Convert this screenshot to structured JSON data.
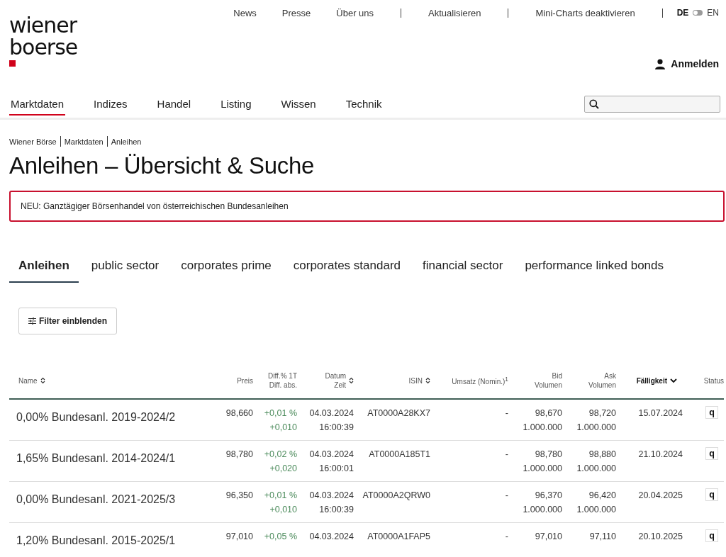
{
  "logo": {
    "line1": "wiener",
    "line2": "boerse"
  },
  "top_link_groups": [
    [
      "News",
      "Presse",
      "Über uns"
    ],
    [
      "Aktualisieren"
    ],
    [
      "Mini-Charts deaktivieren"
    ]
  ],
  "languages": [
    {
      "label": "DE",
      "selected": true
    },
    {
      "label": "EN",
      "selected": false
    }
  ],
  "login": "Anmelden",
  "nav": [
    {
      "label": "Marktdaten",
      "selected": true
    },
    {
      "label": "Indizes",
      "selected": false
    },
    {
      "label": "Handel",
      "selected": false
    },
    {
      "label": "Listing",
      "selected": false
    },
    {
      "label": "Wissen",
      "selected": false
    },
    {
      "label": "Technik",
      "selected": false
    }
  ],
  "breadcrumbs": [
    "Wiener Börse",
    "Marktdaten",
    "Anleihen"
  ],
  "title": "Anleihen – Übersicht & Suche",
  "notice": "NEU: Ganztägiger Börsenhandel von österreichischen Bundesanleihen",
  "tabs": [
    {
      "label": "Anleihen",
      "selected": true
    },
    {
      "label": "public sector",
      "selected": false
    },
    {
      "label": "corporates prime",
      "selected": false
    },
    {
      "label": "corporates standard",
      "selected": false
    },
    {
      "label": "financial sector",
      "selected": false
    },
    {
      "label": "performance linked bonds",
      "selected": false
    }
  ],
  "filter_button": "Filter einblenden",
  "table": {
    "columns": [
      {
        "label": "Name",
        "sortable": true,
        "sorted": false
      },
      {
        "label": "Preis",
        "sortable": false,
        "sorted": false
      },
      {
        "label": "Diff.% 1T",
        "label2": "Diff. abs.",
        "sortable": false,
        "sorted": false
      },
      {
        "label": "Datum",
        "label2": "Zeit",
        "sortable": true,
        "sorted": false
      },
      {
        "label": "ISIN",
        "sortable": true,
        "sorted": false
      },
      {
        "label": "Umsatz (Nomin.)$^{1}$",
        "sortable": false,
        "sorted": false
      },
      {
        "label": "Bid",
        "label2": "Volumen",
        "sortable": false,
        "sorted": false
      },
      {
        "label": "Ask",
        "label2": "Volumen",
        "sortable": false,
        "sorted": false
      },
      {
        "label": "Fälligkeit",
        "sortable": false,
        "sorted": true
      },
      {
        "label": "Status",
        "sortable": false,
        "sorted": false
      }
    ],
    "rows": [
      {
        "name": "0,00% Bundesanl. 2019-2024/2",
        "price": "98,660",
        "diff_pct": "+0,01 %",
        "diff_abs": "+0,010",
        "date": "04.03.2024",
        "time": "16:00:39",
        "isin": "AT0000A28KX7",
        "turnover": "-",
        "bid": "98,670",
        "bid_volume": "1.000.000",
        "ask": "98,720",
        "ask_volume": "1.000.000",
        "maturity": "15.07.2024",
        "status": "q"
      },
      {
        "name": "1,65% Bundesanl. 2014-2024/1",
        "price": "98,780",
        "diff_pct": "+0,02 %",
        "diff_abs": "+0,020",
        "date": "04.03.2024",
        "time": "16:00:01",
        "isin": "AT0000A185T1",
        "turnover": "-",
        "bid": "98,780",
        "bid_volume": "1.000.000",
        "ask": "98,880",
        "ask_volume": "1.000.000",
        "maturity": "21.10.2024",
        "status": "q"
      },
      {
        "name": "0,00% Bundesanl. 2021-2025/3",
        "price": "96,350",
        "diff_pct": "+0,01 %",
        "diff_abs": "+0,010",
        "date": "04.03.2024",
        "time": "16:00:39",
        "isin": "AT0000A2QRW0",
        "turnover": "-",
        "bid": "96,370",
        "bid_volume": "1.000.000",
        "ask": "96,420",
        "ask_volume": "1.000.000",
        "maturity": "20.04.2025",
        "status": "q"
      },
      {
        "name": "1,20% Bundesanl. 2015-2025/1",
        "price": "97,010",
        "diff_pct": "+0,05 %",
        "date": "04.03.2024",
        "isin": "AT0000A1FAP5",
        "turnover": "-",
        "bid": "97,010",
        "ask": "97,110",
        "maturity": "20.10.2025",
        "status": "q"
      }
    ]
  }
}
